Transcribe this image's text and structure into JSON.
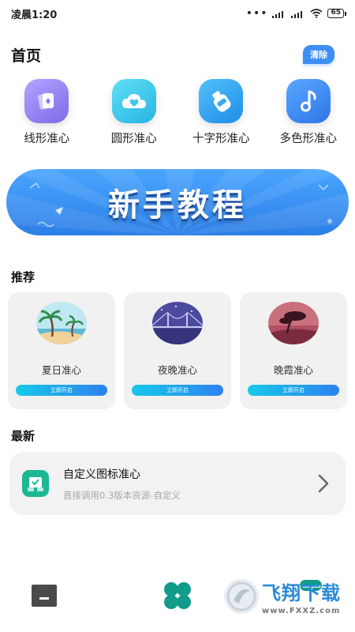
{
  "status_bar": {
    "time": "凌晨1:20",
    "battery": "65"
  },
  "header": {
    "title": "首页",
    "clear_label": "清除"
  },
  "categories": [
    {
      "label": "线形准心",
      "icon": "cards-icon",
      "color": "#8f7df2"
    },
    {
      "label": "圆形准心",
      "icon": "cloud-heart-icon",
      "color": "#3fc9ea"
    },
    {
      "label": "十字形准心",
      "icon": "bottle-icon",
      "color": "#2ea6f0"
    },
    {
      "label": "多色形准心",
      "icon": "music-note-icon",
      "color": "#3f8ff3"
    }
  ],
  "banner": {
    "text": "新手教程"
  },
  "recommend": {
    "title": "推荐",
    "items": [
      {
        "name": "夏日准心",
        "button": "立即开启",
        "icon": "beach-palm-icon"
      },
      {
        "name": "夜晚准心",
        "button": "立即开启",
        "icon": "night-bridge-icon"
      },
      {
        "name": "晚霞准心",
        "button": "立即开启",
        "icon": "sunset-tree-icon"
      }
    ]
  },
  "latest": {
    "title": "最新",
    "item": {
      "title": "自定义图标准心",
      "subtitle": "直接调用0.3版本资源-自定义",
      "icon": "custom-image-icon"
    }
  },
  "bottom_nav": [
    {
      "icon": "home-icon"
    },
    {
      "icon": "clover-icon"
    },
    {
      "icon": "profile-icon"
    }
  ],
  "watermark": {
    "title": "飞翔下载",
    "url": "www.FXXZ.com"
  },
  "colors": {
    "accent": "#3e8ff5",
    "latest_icon": "#1bb893",
    "nav_active": "#129a8a"
  }
}
